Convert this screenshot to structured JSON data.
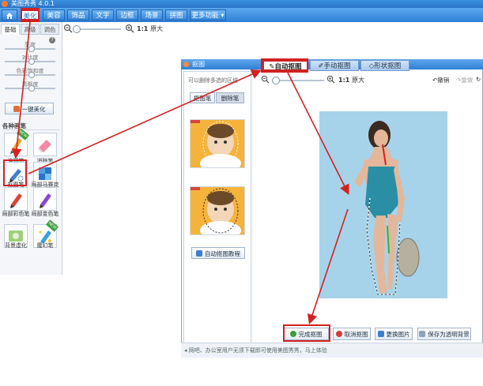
{
  "app": {
    "title": "美图秀秀 4.0.1"
  },
  "menu": {
    "items": [
      "美化",
      "美容",
      "饰品",
      "文字",
      "边框",
      "场景",
      "拼图",
      "更多功能"
    ],
    "active": "美化"
  },
  "left_panel": {
    "tabs": [
      "基础",
      "高级",
      "调色"
    ],
    "sliders": [
      "亮度",
      "对比度",
      "色彩饱和度",
      "清晰度"
    ],
    "one_key_button": "一键美化",
    "section_title": "各种画笔",
    "tools": [
      "涂鸦笔",
      "消除笔",
      "抠图笔",
      "局部马赛克",
      "局部彩色笔",
      "局部变色笔",
      "背景虚化",
      "魔幻笔"
    ],
    "new_badge": "NEW"
  },
  "main_toolbar": {
    "zoom_label": "1:1",
    "zoom_suffix": "原大"
  },
  "dialog": {
    "title": "抠图",
    "tabs": [
      "自动抠图",
      "手动抠图",
      "形状抠图"
    ],
    "active_tab": "自动抠图",
    "hint": "可以删除多选的区域",
    "pen_tabs": [
      "抠图笔",
      "删除笔"
    ],
    "tutorial_button": "自动抠图教程",
    "zoom_label": "1:1",
    "zoom_suffix": "原大",
    "undo": "撤销",
    "redo": "重做",
    "actions": {
      "finish": "完成抠图",
      "cancel": "取消抠图",
      "replace": "更换图片",
      "save_transparent": "保存为透明背景"
    },
    "status": "网吧、办公室用户无须下载即可使用美图秀秀，马上体验"
  },
  "colors": {
    "accent": "#2f7fd4",
    "annotation": "#d42020",
    "photo_bg": "#a7d3ea",
    "thumb_bg": "#f6b33c"
  }
}
